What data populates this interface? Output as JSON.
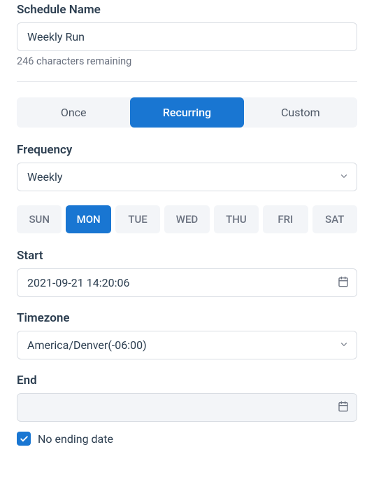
{
  "scheduleName": {
    "label": "Schedule Name",
    "value": "Weekly Run",
    "helper": "246 characters remaining"
  },
  "scheduleType": {
    "options": [
      "Once",
      "Recurring",
      "Custom"
    ],
    "active": "Recurring"
  },
  "frequency": {
    "label": "Frequency",
    "value": "Weekly"
  },
  "days": {
    "items": [
      "SUN",
      "MON",
      "TUE",
      "WED",
      "THU",
      "FRI",
      "SAT"
    ],
    "active": "MON"
  },
  "start": {
    "label": "Start",
    "value": "2021-09-21 14:20:06"
  },
  "timezone": {
    "label": "Timezone",
    "value": "America/Denver(-06:00)"
  },
  "end": {
    "label": "End",
    "value": "",
    "noEndingChecked": true,
    "noEndingLabel": "No ending date"
  }
}
